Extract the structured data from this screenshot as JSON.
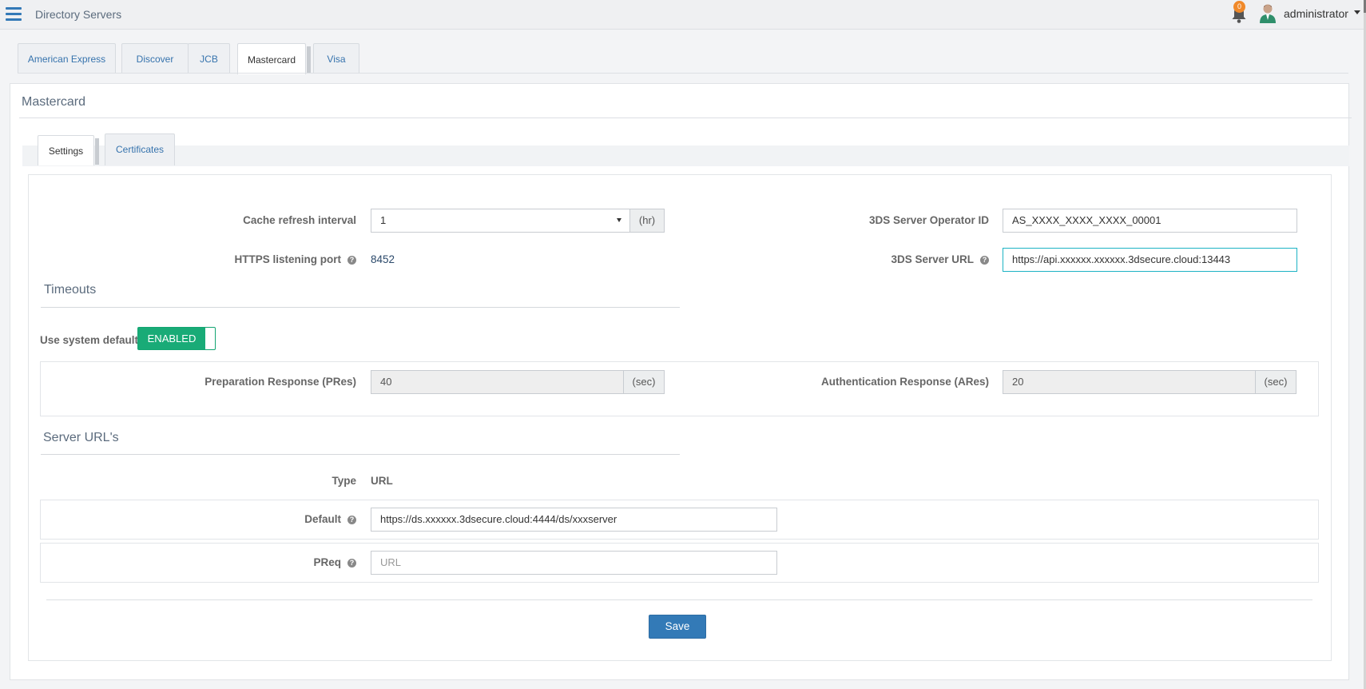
{
  "header": {
    "title": "Directory Servers",
    "notification_count": "0",
    "user": "administrator"
  },
  "brand_tabs": [
    "American Express",
    "Discover",
    "JCB",
    "Mastercard",
    "Visa"
  ],
  "panel": {
    "title": "Mastercard",
    "sub_tabs": [
      "Settings",
      "Certificates"
    ]
  },
  "settings": {
    "cache_refresh_label": "Cache refresh interval",
    "cache_refresh_value": "1",
    "cache_refresh_unit": "(hr)",
    "https_port_label": "HTTPS listening port",
    "https_port_value": "8452",
    "operator_id_label": "3DS Server Operator ID",
    "operator_id_value": "AS_XXXX_XXXX_XXXX_00001",
    "server_url_label": "3DS Server URL",
    "server_url_value": "https://api.xxxxxx.xxxxxx.3dsecure.cloud:13443"
  },
  "timeouts": {
    "section_title": "Timeouts",
    "use_default_label": "Use system default",
    "toggle_label": "ENABLED",
    "pres_label": "Preparation Response (PRes)",
    "pres_value": "40",
    "pres_unit": "(sec)",
    "ares_label": "Authentication Response (ARes)",
    "ares_value": "20",
    "ares_unit": "(sec)"
  },
  "server_urls": {
    "section_title": "Server URL's",
    "type_header": "Type",
    "url_header": "URL",
    "default_label": "Default",
    "default_value": "https://ds.xxxxxx.3dsecure.cloud:4444/ds/xxxserver",
    "preq_label": "PReq",
    "preq_placeholder": "URL"
  },
  "actions": {
    "save_label": "Save"
  },
  "colors": {
    "primary": "#337ab7",
    "toggle_on": "#19ab77",
    "badge": "#f0892a",
    "focus_border": "#1db3c4"
  },
  "icons": {
    "menu": "hamburger-menu-icon",
    "bell": "bell-icon",
    "avatar": "user-avatar-icon",
    "help": "question-circle-icon",
    "caret": "caret-down-icon"
  }
}
